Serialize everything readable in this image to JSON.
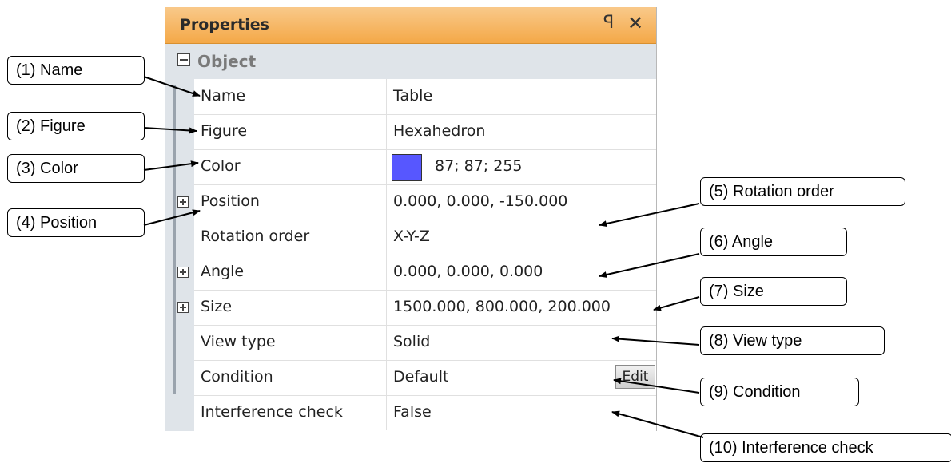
{
  "panel": {
    "title": "Properties",
    "pin_glyph": "ꟼ",
    "close_glyph": "✕",
    "category": "Object",
    "rows": [
      {
        "name": "Name",
        "value": "Table"
      },
      {
        "name": "Figure",
        "value": "Hexahedron"
      },
      {
        "name": "Color",
        "value": "87; 87; 255",
        "swatch_color": "#5757ff"
      },
      {
        "name": "Position",
        "value": "0.000, 0.000, -150.000"
      },
      {
        "name": "Rotation order",
        "value": "X-Y-Z"
      },
      {
        "name": "Angle",
        "value": "0.000, 0.000, 0.000"
      },
      {
        "name": "Size",
        "value": "1500.000, 800.000, 200.000"
      },
      {
        "name": "View type",
        "value": "Solid"
      },
      {
        "name": "Condition",
        "value": "Default",
        "button": "Edit"
      },
      {
        "name": "Interference check",
        "value": "False"
      }
    ]
  },
  "callouts": [
    "(1) Name",
    "(2) Figure",
    "(3) Color",
    "(4) Position",
    "(5) Rotation order",
    "(6) Angle",
    "(7) Size",
    "(8) View type",
    "(9) Condition",
    "(10) Interference check"
  ],
  "colors": {
    "titlebar": "#f4a847",
    "category_band": "#dfe4e9",
    "swatch": "#5757ff"
  }
}
